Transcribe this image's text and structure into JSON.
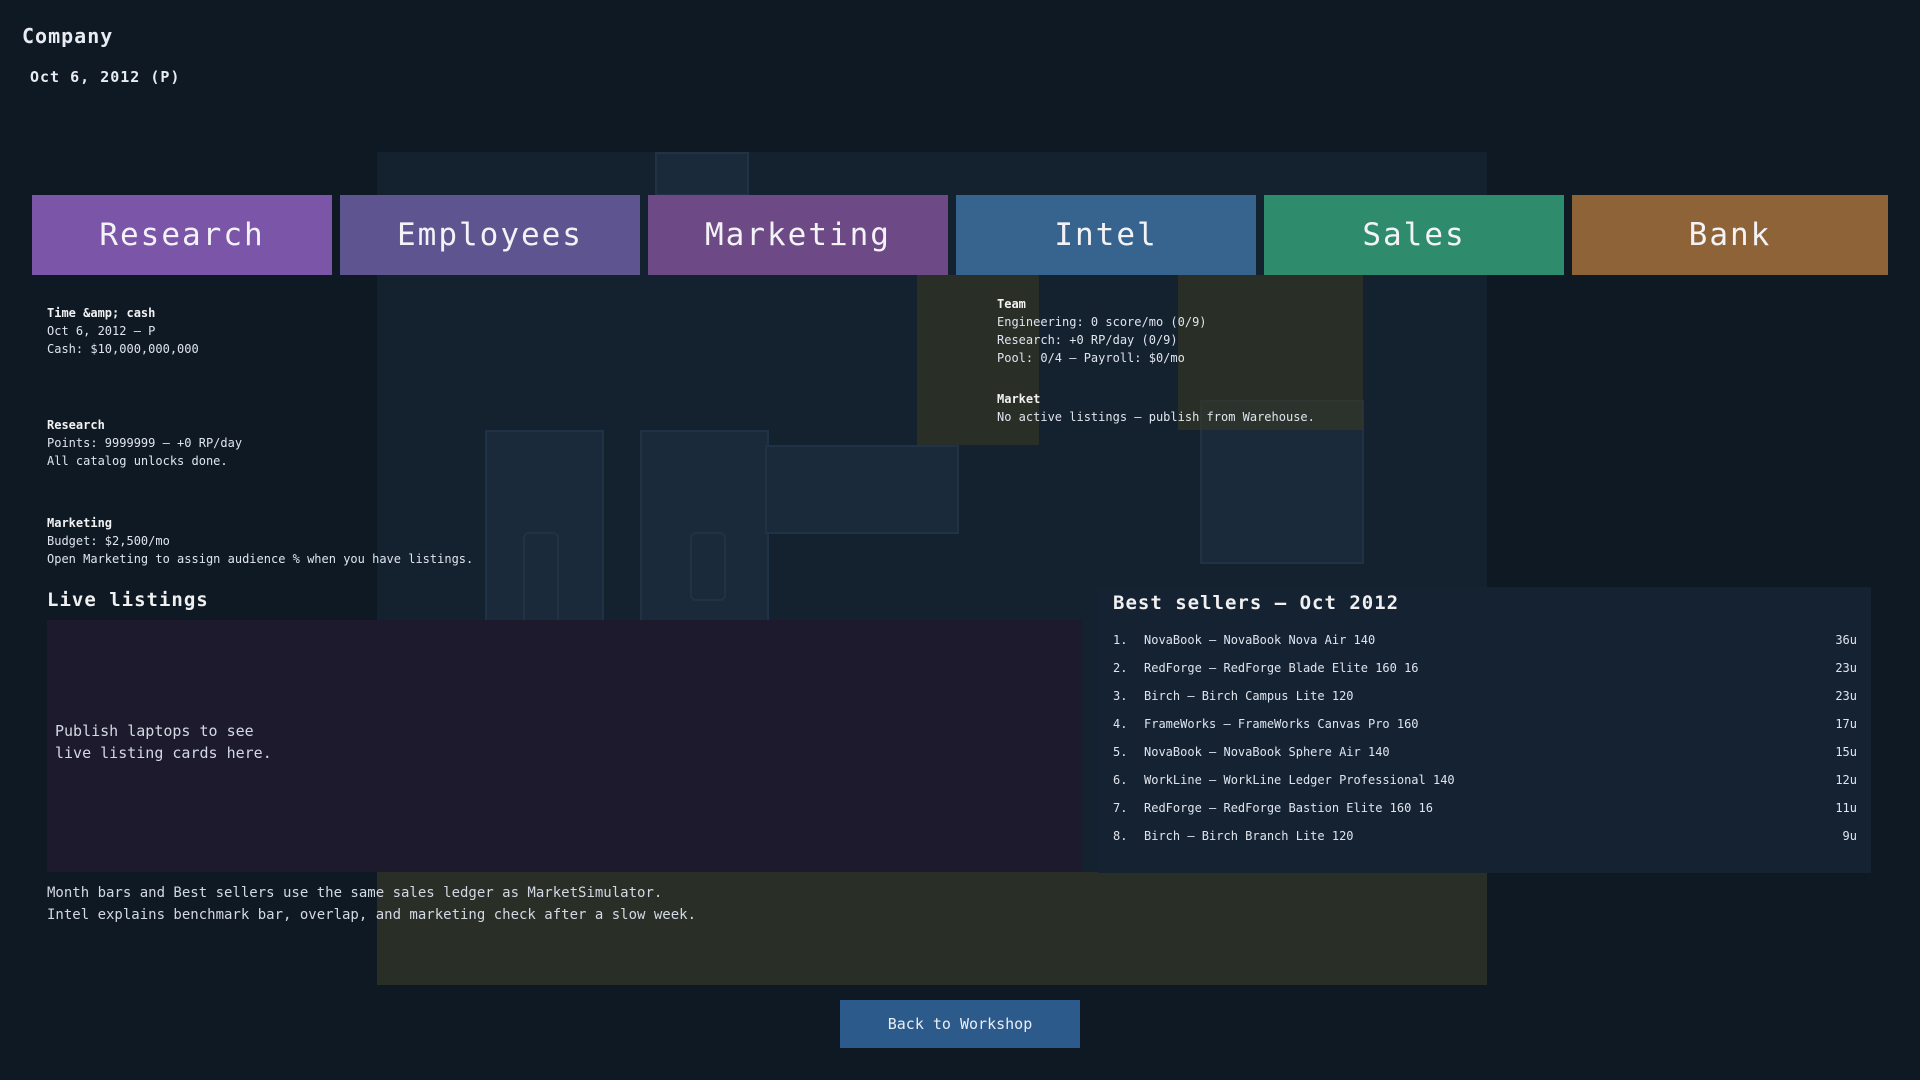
{
  "header": {
    "title": "Company",
    "date": "Oct 6, 2012 (P)"
  },
  "tabs": [
    {
      "label": "Research",
      "color": "#7a55a8"
    },
    {
      "label": "Employees",
      "color": "#5e5590"
    },
    {
      "label": "Marketing",
      "color": "#6d4a85"
    },
    {
      "label": "Intel",
      "color": "#37648e"
    },
    {
      "label": "Sales",
      "color": "#2e8b6c"
    },
    {
      "label": "Bank",
      "color": "#8e6337"
    }
  ],
  "time_cash": {
    "heading": "Time &amp; cash",
    "date_line": "Oct 6, 2012  –  P",
    "cash": "Cash: $10,000,000,000"
  },
  "research": {
    "heading": "Research",
    "points": "Points: 9999999  –  +0 RP/day",
    "status": "All catalog unlocks done."
  },
  "marketing": {
    "heading": "Marketing",
    "budget": "Budget: $2,500/mo",
    "hint": "Open Marketing to assign audience % when you have listings."
  },
  "team": {
    "heading": "Team",
    "engineering": "Engineering: 0 score/mo (0/9)",
    "research": "Research: +0 RP/day (0/9)",
    "pool": "Pool: 0/4  –  Payroll: $0/mo"
  },
  "market": {
    "heading": "Market",
    "status": "No active listings – publish from Warehouse."
  },
  "live_listings": {
    "heading": "Live listings",
    "empty_line1": "Publish laptops to see",
    "empty_line2": "live listing cards here."
  },
  "best_sellers": {
    "title": "Best sellers – Oct 2012",
    "rows": [
      {
        "rank": "1.",
        "name": "NovaBook – NovaBook Nova Air 140",
        "units": "36u"
      },
      {
        "rank": "2.",
        "name": "RedForge – RedForge Blade Elite 160 16",
        "units": "23u"
      },
      {
        "rank": "3.",
        "name": "Birch – Birch Campus Lite 120",
        "units": "23u"
      },
      {
        "rank": "4.",
        "name": "FrameWorks – FrameWorks Canvas Pro 160",
        "units": "17u"
      },
      {
        "rank": "5.",
        "name": "NovaBook – NovaBook Sphere Air 140",
        "units": "15u"
      },
      {
        "rank": "6.",
        "name": "WorkLine – WorkLine Ledger Professional 140",
        "units": "12u"
      },
      {
        "rank": "7.",
        "name": "RedForge – RedForge Bastion Elite 160 16",
        "units": "11u"
      },
      {
        "rank": "8.",
        "name": "Birch – Birch Branch Lite 120",
        "units": "9u"
      }
    ]
  },
  "footer_note": {
    "line1": "Month bars and Best sellers use the same sales ledger as MarketSimulator.",
    "line2": "Intel explains benchmark bar, overlap, and marketing   check after a slow week."
  },
  "back_button": "Back to Workshop"
}
